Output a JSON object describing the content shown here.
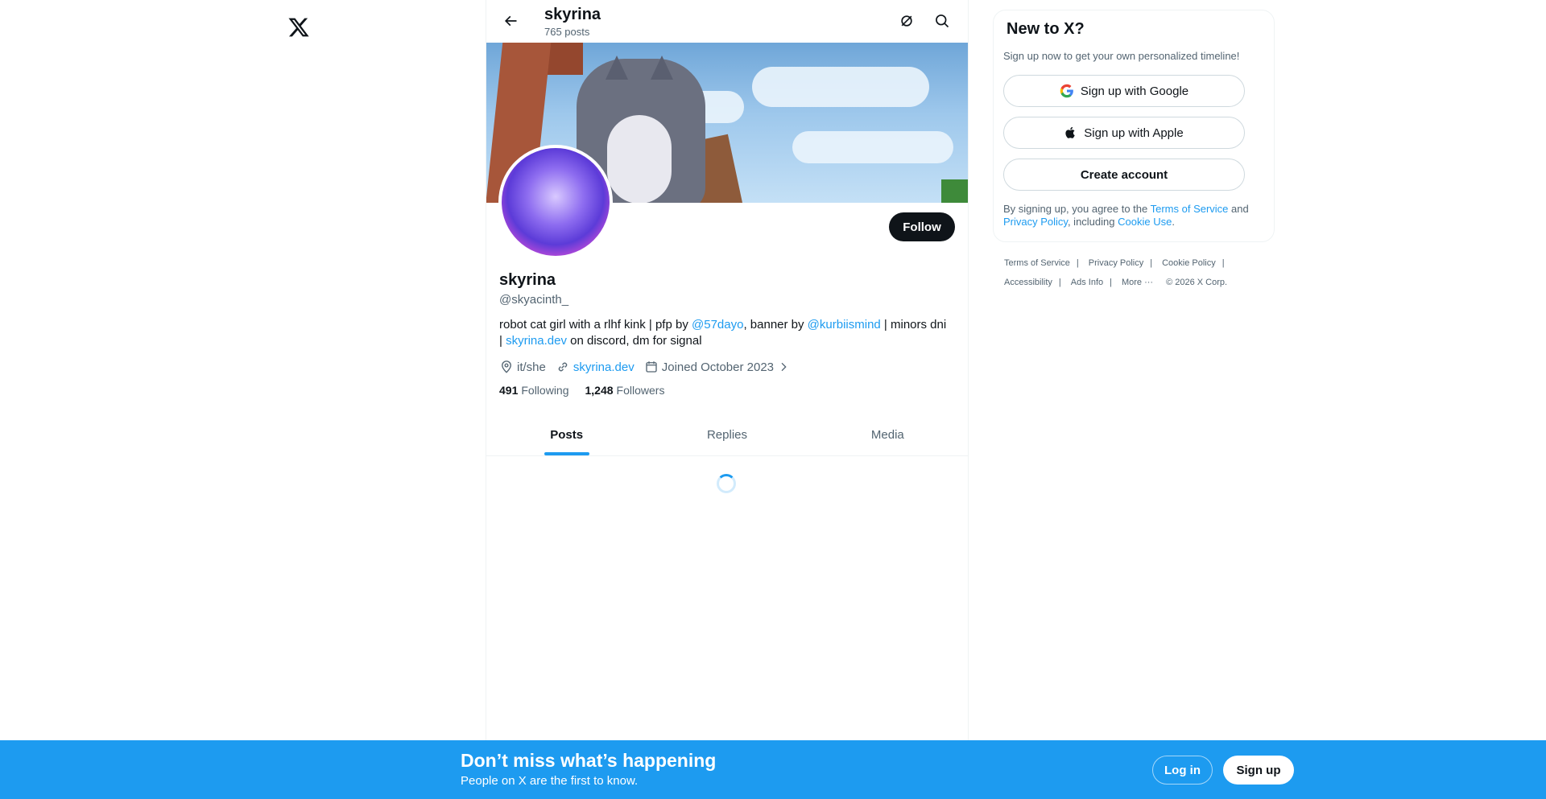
{
  "header": {
    "title": "skyrina",
    "post_count": "765 posts"
  },
  "profile": {
    "display_name": "skyrina",
    "handle": "@skyacinth_",
    "follow_label": "Follow",
    "bio": {
      "part1": "robot cat girl with a rlhf kink | pfp by ",
      "mention1": "@57dayo",
      "part2": ", banner by ",
      "mention2": "@kurbiismind",
      "part3": " | minors dni | ",
      "link": "skyrina.dev",
      "part4": " on discord, dm for signal"
    },
    "location": "it/she",
    "website": "skyrina.dev",
    "joined": "Joined October 2023",
    "following_count": "491",
    "following_label": "Following",
    "followers_count": "1,248",
    "followers_label": "Followers"
  },
  "tabs": [
    {
      "label": "Posts",
      "active": true
    },
    {
      "label": "Replies",
      "active": false
    },
    {
      "label": "Media",
      "active": false
    }
  ],
  "signup_card": {
    "title": "New to X?",
    "subtitle": "Sign up now to get your own personalized timeline!",
    "google_label": "Sign up with Google",
    "apple_label": "Sign up with Apple",
    "create_label": "Create account",
    "legal_prefix": "By signing up, you agree to the ",
    "terms": "Terms of Service",
    "and": " and ",
    "privacy": "Privacy Policy",
    "including": ", including ",
    "cookie": "Cookie Use",
    "period": "."
  },
  "footer": {
    "terms": "Terms of Service",
    "privacy": "Privacy Policy",
    "cookie": "Cookie Policy",
    "accessibility": "Accessibility",
    "ads": "Ads Info",
    "more": "More ···",
    "copyright": "© 2026 X Corp."
  },
  "bottom_bar": {
    "title": "Don’t miss what’s happening",
    "subtitle": "People on X are the first to know.",
    "login_label": "Log in",
    "signup_label": "Sign up"
  },
  "colors": {
    "accent": "#1d9bf0",
    "text": "#0f1419",
    "muted": "#536471"
  }
}
